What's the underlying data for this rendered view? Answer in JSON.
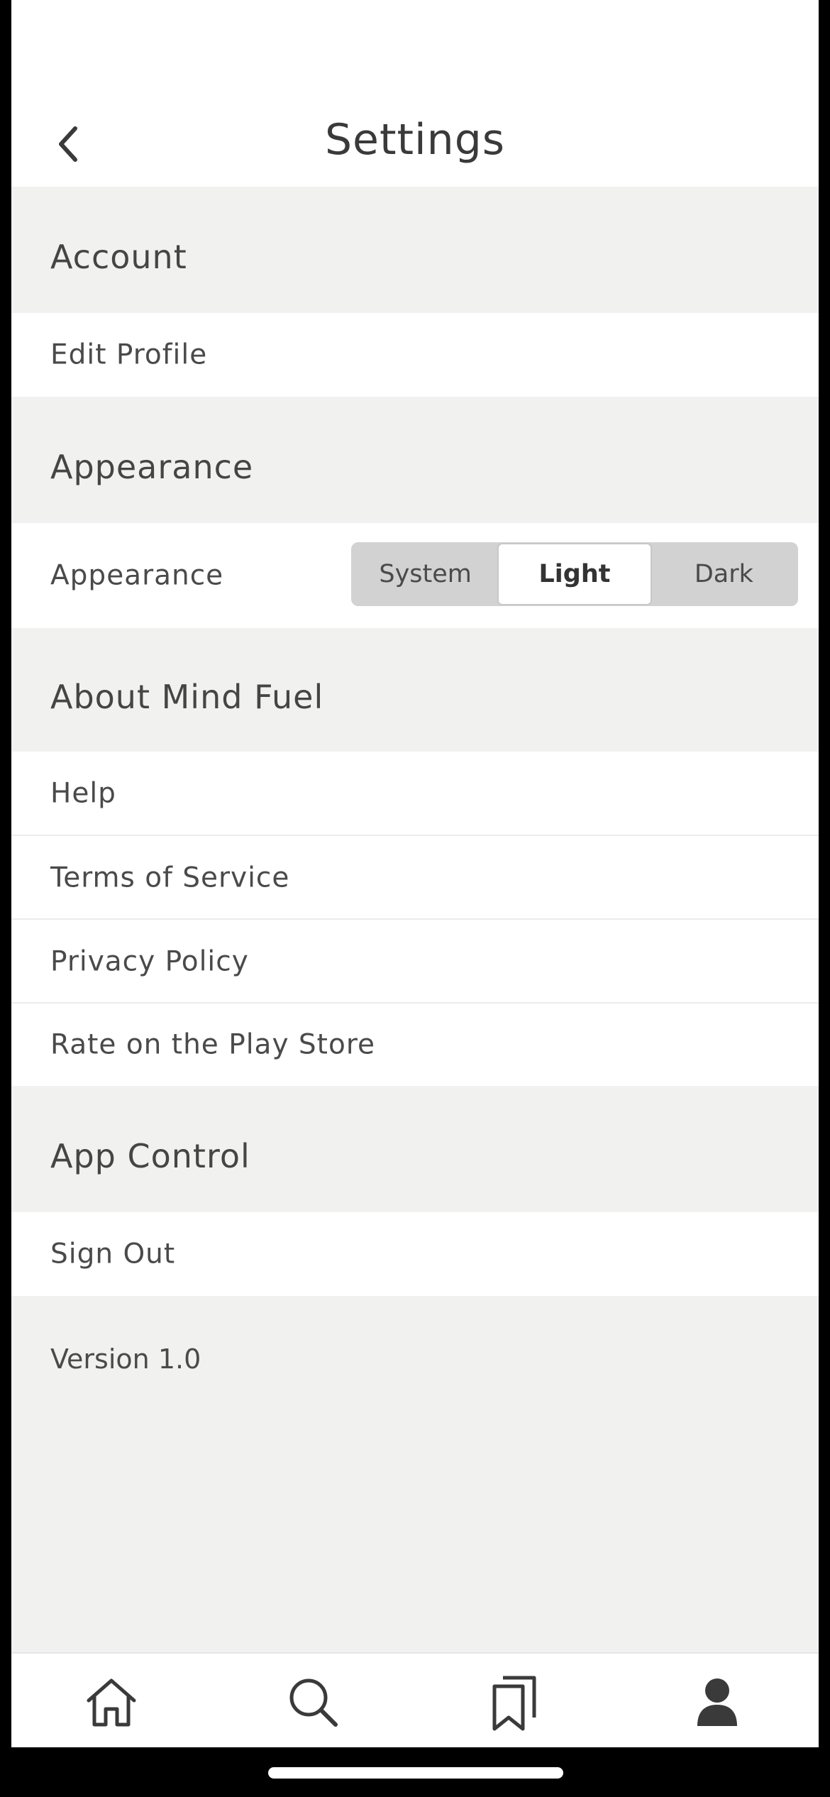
{
  "header": {
    "title": "Settings",
    "back_icon": "chevron-left-icon"
  },
  "sections": {
    "account": {
      "title": "Account",
      "items": [
        "Edit Profile"
      ]
    },
    "appearance": {
      "title": "Appearance",
      "row_label": "Appearance",
      "options": [
        "System",
        "Light",
        "Dark"
      ],
      "selected": "Light"
    },
    "about": {
      "title": "About Mind Fuel",
      "items": [
        "Help",
        "Terms of Service",
        "Privacy Policy",
        "Rate on the Play Store"
      ]
    },
    "app_control": {
      "title": "App Control",
      "items": [
        "Sign Out"
      ]
    }
  },
  "version": "Version 1.0",
  "tabbar": {
    "items": [
      {
        "icon": "home-icon"
      },
      {
        "icon": "search-icon"
      },
      {
        "icon": "bookmarks-icon"
      },
      {
        "icon": "profile-icon"
      }
    ]
  },
  "colors": {
    "background": "#f1f2f0",
    "surface": "#ffffff",
    "text": "#3a3a3a",
    "segment": "#d2d2d2"
  }
}
